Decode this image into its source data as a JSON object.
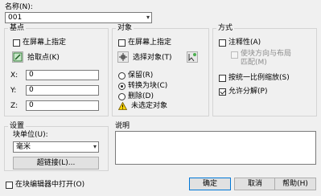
{
  "name": {
    "label": "名称(N):",
    "value": "001"
  },
  "basepoint": {
    "title": "基点",
    "specify_on_screen": "在屏幕上指定",
    "pick_point": "拾取点(K)",
    "x_label": "X:",
    "x_value": "0",
    "y_label": "Y:",
    "y_value": "0",
    "z_label": "Z:",
    "z_value": "0"
  },
  "objects": {
    "title": "对象",
    "specify_on_screen": "在屏幕上指定",
    "select_objects": "选择对象(T)",
    "retain": "保留(R)",
    "convert_to_block": "转换为块(C)",
    "delete": "删除(D)",
    "warning": "未选定对象"
  },
  "behavior": {
    "title": "方式",
    "annotative": "注释性(A)",
    "match_orientation_line1": "使块方向与布局",
    "match_orientation_line2": "匹配(M)",
    "scale_uniformly": "按统一比例缩放(S)",
    "allow_exploding": "允许分解(P)"
  },
  "settings": {
    "title": "设置",
    "block_unit_label": "块单位(U):",
    "block_unit_value": "毫米",
    "hyperlink": "超链接(L)..."
  },
  "description": {
    "title": "说明"
  },
  "open_in_editor": "在块编辑器中打开(O)",
  "buttons": {
    "ok": "确定",
    "cancel": "取消",
    "help": "帮助(H)"
  },
  "icons": {
    "pick_point": "pick-point-icon",
    "select_objects": "select-objects-icon",
    "quick_select": "quick-select-icon",
    "warning": "warning-icon"
  }
}
